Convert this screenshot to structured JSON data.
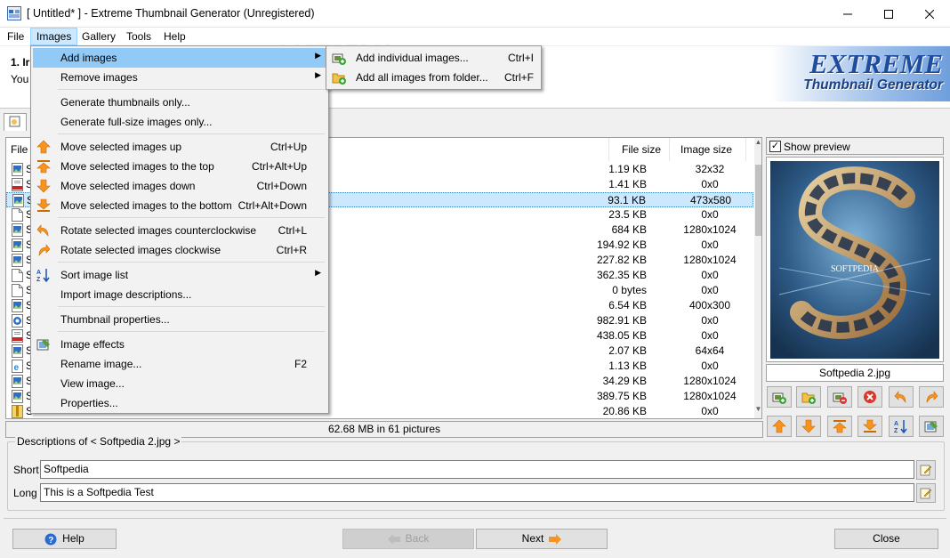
{
  "window": {
    "title": "[ Untitled* ] - Extreme Thumbnail Generator (Unregistered)"
  },
  "menubar": {
    "items": [
      "File",
      "Images",
      "Gallery",
      "Tools",
      "Help"
    ],
    "active": "Images"
  },
  "header": {
    "step": "1. Ir",
    "sub": "You"
  },
  "logo": {
    "line1": "EXTREME",
    "line2": "Thumbnail Generator"
  },
  "watermark": "SOFTPEDIA",
  "filelist": {
    "columns": {
      "name": "File n",
      "size": "File size",
      "dim": "Image size"
    },
    "rows": [
      {
        "n": "S",
        "size": "1.19 KB",
        "dim": "32x32",
        "icon": "image-file-icon"
      },
      {
        "n": "S",
        "size": "1.41 KB",
        "dim": "0x0",
        "icon": "pdf-file-icon"
      },
      {
        "n": "S",
        "size": "93.1 KB",
        "dim": "473x580",
        "icon": "image-file-icon",
        "selected": true
      },
      {
        "n": "S",
        "size": "23.5 KB",
        "dim": "0x0",
        "icon": "blank-file-icon"
      },
      {
        "n": "S",
        "size": "684 KB",
        "dim": "1280x1024",
        "icon": "image-file-icon"
      },
      {
        "n": "S",
        "size": "194.92 KB",
        "dim": "0x0",
        "icon": "image-file-icon"
      },
      {
        "n": "S",
        "size": "227.82 KB",
        "dim": "1280x1024",
        "icon": "image-file-icon"
      },
      {
        "n": "S",
        "size": "362.35 KB",
        "dim": "0x0",
        "icon": "blank-file-icon"
      },
      {
        "n": "S",
        "size": "0 bytes",
        "dim": "0x0",
        "icon": "blank-file-icon"
      },
      {
        "n": "S",
        "size": "6.54 KB",
        "dim": "400x300",
        "icon": "image-file-icon"
      },
      {
        "n": "S",
        "size": "982.91 KB",
        "dim": "0x0",
        "icon": "chrome-file-icon"
      },
      {
        "n": "S",
        "size": "438.05 KB",
        "dim": "0x0",
        "icon": "pdf-file-icon"
      },
      {
        "n": "S",
        "size": "2.07 KB",
        "dim": "64x64",
        "icon": "image-file-icon"
      },
      {
        "n": "S",
        "size": "1.13 KB",
        "dim": "0x0",
        "icon": "ie-file-icon"
      },
      {
        "n": "S",
        "size": "34.29 KB",
        "dim": "1280x1024",
        "icon": "image-file-icon"
      },
      {
        "n": "S",
        "size": "389.75 KB",
        "dim": "1280x1024",
        "icon": "image-file-icon"
      },
      {
        "n": "S",
        "size": "20.86 KB",
        "dim": "0x0",
        "icon": "zip-file-icon"
      }
    ]
  },
  "status": "62.68 MB in 61 pictures",
  "preview": {
    "checkbox_label": "Show preview",
    "checked": true,
    "filename": "Softpedia 2.jpg",
    "image_text": "SOFTPEDIA"
  },
  "descriptions": {
    "legend": "Descriptions of < Softpedia 2.jpg >",
    "short_label": "Short",
    "short_value": "Softpedia",
    "long_label": "Long",
    "long_value": "This is a Softpedia Test"
  },
  "buttons": {
    "help": "Help",
    "back": "Back",
    "next": "Next",
    "close": "Close"
  },
  "dropdown": [
    {
      "label": "Add images",
      "shortcut": "",
      "submenu": true,
      "icon": "",
      "highlight": true
    },
    {
      "label": "Remove images",
      "shortcut": "",
      "submenu": true,
      "icon": ""
    },
    {
      "sep": true
    },
    {
      "label": "Generate thumbnails only...",
      "shortcut": "",
      "icon": ""
    },
    {
      "label": "Generate full-size images only...",
      "shortcut": "",
      "icon": ""
    },
    {
      "sep": true
    },
    {
      "label": "Move selected images up",
      "shortcut": "Ctrl+Up",
      "icon": "arrow-up-icon"
    },
    {
      "label": "Move selected images to the top",
      "shortcut": "Ctrl+Alt+Up",
      "icon": "arrow-top-icon"
    },
    {
      "label": "Move selected images down",
      "shortcut": "Ctrl+Down",
      "icon": "arrow-down-icon"
    },
    {
      "label": "Move selected images to the bottom",
      "shortcut": "Ctrl+Alt+Down",
      "icon": "arrow-bottom-icon"
    },
    {
      "sep": true
    },
    {
      "label": "Rotate selected images counterclockwise",
      "shortcut": "Ctrl+L",
      "icon": "rotate-ccw-icon"
    },
    {
      "label": "Rotate selected images clockwise",
      "shortcut": "Ctrl+R",
      "icon": "rotate-cw-icon"
    },
    {
      "sep": true
    },
    {
      "label": "Sort image list",
      "shortcut": "",
      "submenu": true,
      "icon": "sort-az-icon"
    },
    {
      "label": "Import image descriptions...",
      "shortcut": "",
      "icon": ""
    },
    {
      "sep": true
    },
    {
      "label": "Thumbnail properties...",
      "shortcut": "",
      "icon": ""
    },
    {
      "sep": true
    },
    {
      "label": "Image effects",
      "shortcut": "",
      "icon": "image-effects-icon"
    },
    {
      "label": "Rename image...",
      "shortcut": "F2",
      "icon": ""
    },
    {
      "label": "View image...",
      "shortcut": "",
      "icon": ""
    },
    {
      "label": "Properties...",
      "shortcut": "",
      "icon": ""
    }
  ],
  "submenu": [
    {
      "label": "Add individual images...",
      "shortcut": "Ctrl+I",
      "icon": "add-images-icon"
    },
    {
      "label": "Add all images from folder...",
      "shortcut": "Ctrl+F",
      "icon": "add-folder-icon"
    }
  ],
  "toolbar_icons": [
    "add-images-icon",
    "add-folder-icon",
    "remove-images-icon",
    "delete-icon",
    "rotate-ccw-icon",
    "rotate-cw-icon",
    "arrow-up-icon",
    "arrow-down-icon",
    "arrow-top-icon",
    "arrow-bottom-icon",
    "sort-az-icon",
    "image-effects-icon"
  ],
  "colors": {
    "menu_highlight": "#91c9f7",
    "selection": "#cce8ff",
    "arrow_orange": "#f7931e",
    "logo_blue": "#1e4d9e"
  }
}
